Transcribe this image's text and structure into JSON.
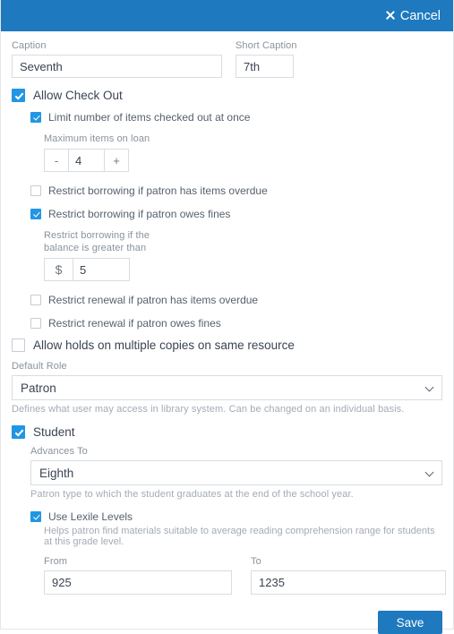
{
  "header": {
    "cancel_label": "Cancel",
    "cancel_icon": "close-icon",
    "background_color": "#1e79bf"
  },
  "form": {
    "caption": {
      "label": "Caption",
      "value": "Seventh"
    },
    "short_caption": {
      "label": "Short Caption",
      "value": "7th"
    },
    "allow_check_out": {
      "label": "Allow Check Out",
      "checked": true
    },
    "limit_items": {
      "label": "Limit number of items checked out at once",
      "checked": true
    },
    "max_items": {
      "label": "Maximum items on loan",
      "value": "4",
      "decrement_label": "-",
      "increment_label": "+"
    },
    "restrict_borrow_overdue": {
      "label": "Restrict borrowing if patron has items overdue",
      "checked": false
    },
    "restrict_borrow_fines": {
      "label": "Restrict borrowing if patron owes fines",
      "checked": true
    },
    "balance_limit": {
      "label": "Restrict borrowing if the balance is greater than",
      "prefix": "$",
      "value": "5"
    },
    "restrict_renewal_overdue": {
      "label": "Restrict renewal if patron has items overdue",
      "checked": false
    },
    "restrict_renewal_fines": {
      "label": "Restrict renewal if patron owes fines",
      "checked": false
    },
    "allow_holds": {
      "label": "Allow holds on multiple copies on same resource",
      "checked": false
    },
    "default_role": {
      "label": "Default Role",
      "value": "Patron",
      "help": "Defines what user may access in library system. Can be changed on an individual basis."
    },
    "student": {
      "label": "Student",
      "checked": true
    },
    "advances_to": {
      "label": "Advances To",
      "value": "Eighth",
      "help": "Patron type to which the student graduates at the end of the school year."
    },
    "use_lexile": {
      "label": "Use Lexile Levels",
      "checked": true,
      "help": "Helps patron find materials suitable to average reading comprehension range for students at this grade level."
    },
    "lexile_from": {
      "label": "From",
      "value": "925"
    },
    "lexile_to": {
      "label": "To",
      "value": "1235"
    }
  },
  "footer": {
    "save_label": "Save",
    "save_color": "#1e79bf"
  }
}
